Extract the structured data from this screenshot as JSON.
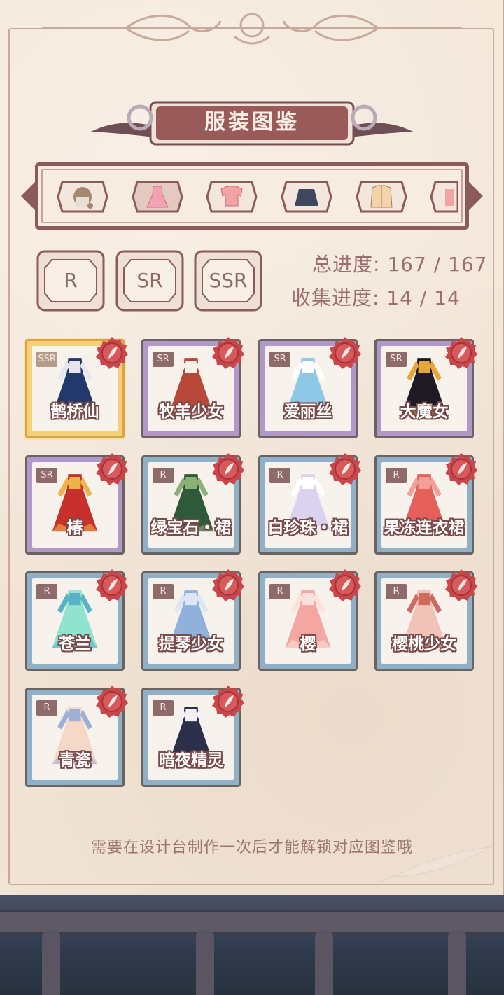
{
  "title": "服装图鉴",
  "categories": [
    {
      "icon": "hair-icon",
      "selected": false
    },
    {
      "icon": "dress-icon",
      "selected": true
    },
    {
      "icon": "top-icon",
      "selected": false
    },
    {
      "icon": "skirt-icon",
      "selected": false
    },
    {
      "icon": "jacket-icon",
      "selected": false
    },
    {
      "icon": "accessory-icon",
      "selected": false
    }
  ],
  "rarity_filters": [
    {
      "label": "R"
    },
    {
      "label": "SR"
    },
    {
      "label": "SSR"
    }
  ],
  "progress": {
    "total_label": "总进度:",
    "total_value": "167 / 167",
    "collect_label": "收集进度:",
    "collect_value": "14 / 14"
  },
  "items": [
    {
      "name": "鹊桥仙",
      "rarity": "SSR",
      "colors": [
        "#223a6b",
        "#e9e4ef"
      ]
    },
    {
      "name": "牧羊少女",
      "rarity": "SR",
      "colors": [
        "#b8483a",
        "#f5f0e8"
      ]
    },
    {
      "name": "爱丽丝",
      "rarity": "SR",
      "colors": [
        "#8fc7e6",
        "#ffffff"
      ]
    },
    {
      "name": "大魔女",
      "rarity": "SR",
      "colors": [
        "#1e1b24",
        "#e7a63a"
      ]
    },
    {
      "name": "椿",
      "rarity": "SR",
      "colors": [
        "#c8302e",
        "#f0b24a"
      ]
    },
    {
      "name": "绿宝石・裙",
      "rarity": "R",
      "colors": [
        "#2f5a3a",
        "#8bb07a"
      ]
    },
    {
      "name": "白珍珠・裙",
      "rarity": "R",
      "colors": [
        "#d9d3ef",
        "#ffffff"
      ]
    },
    {
      "name": "果冻连衣裙",
      "rarity": "R",
      "colors": [
        "#e6605a",
        "#f4a09a"
      ]
    },
    {
      "name": "苍兰",
      "rarity": "R",
      "colors": [
        "#8fe3cf",
        "#5ab2c9"
      ]
    },
    {
      "name": "提琴少女",
      "rarity": "R",
      "colors": [
        "#8fb1dc",
        "#dce6f5"
      ]
    },
    {
      "name": "樱",
      "rarity": "R",
      "colors": [
        "#f4a7a0",
        "#fde0dc"
      ]
    },
    {
      "name": "樱桃少女",
      "rarity": "R",
      "colors": [
        "#f1c2b7",
        "#d16a5e"
      ]
    },
    {
      "name": "青瓷",
      "rarity": "R",
      "colors": [
        "#f6d8c9",
        "#9fb0d6"
      ]
    },
    {
      "name": "暗夜精灵",
      "rarity": "R",
      "colors": [
        "#2b2f4a",
        "#f3f1f5"
      ]
    }
  ],
  "hint": "需要在设计台制作一次后才能解锁对应图鉴哦"
}
